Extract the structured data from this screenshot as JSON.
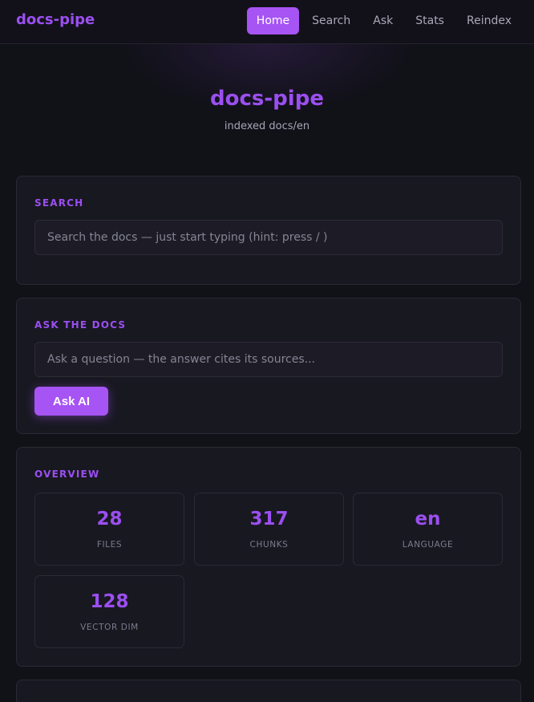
{
  "nav": {
    "brand": "docs-pipe",
    "links": [
      {
        "label": "Home",
        "active": true
      },
      {
        "label": "Search",
        "active": false
      },
      {
        "label": "Ask",
        "active": false
      },
      {
        "label": "Stats",
        "active": false
      },
      {
        "label": "Reindex",
        "active": false
      }
    ]
  },
  "hero": {
    "title": "docs-pipe",
    "subtitle": "indexed docs/en"
  },
  "search": {
    "label": "SEARCH",
    "placeholder": "Search the docs — just start typing (hint: press / )"
  },
  "ask": {
    "label": "ASK THE DOCS",
    "placeholder": "Ask a question — the answer cites its sources...",
    "button": "Ask AI"
  },
  "overview": {
    "label": "OVERVIEW",
    "stats": [
      {
        "value": "28",
        "label": "FILES"
      },
      {
        "value": "317",
        "label": "CHUNKS"
      },
      {
        "value": "en",
        "label": "LANGUAGE"
      },
      {
        "value": "128",
        "label": "VECTOR DIM"
      }
    ]
  },
  "colors": {
    "accent": "#a654f4",
    "accent_text": "#9b4ff0",
    "background": "#111118",
    "card": "#181821"
  }
}
